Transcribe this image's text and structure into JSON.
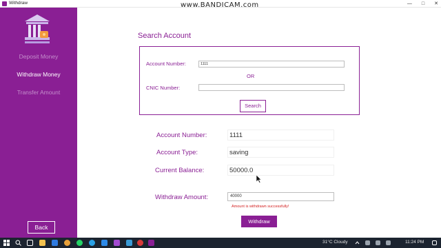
{
  "window": {
    "title": "Withdraw",
    "controls": [
      "—",
      "□",
      "✕"
    ]
  },
  "watermark": "www.BANDICAM.com",
  "sidebar": {
    "items": [
      {
        "label": "Deposit Money",
        "active": false
      },
      {
        "label": "Withdraw Money",
        "active": true
      },
      {
        "label": "Transfer Amount",
        "active": false
      }
    ],
    "back_label": "Back"
  },
  "search": {
    "heading": "Search Account",
    "account_number_label": "Account Number:",
    "account_number_value": "1111",
    "or_label": "OR",
    "cnic_label": "CNIC Number:",
    "cnic_value": "",
    "button_label": "Search"
  },
  "details": {
    "account_number_label": "Account Number:",
    "account_number_value": "1111",
    "account_type_label": "Account Type:",
    "account_type_value": "saving",
    "balance_label": "Current Balance:",
    "balance_value": "50000.0"
  },
  "withdraw": {
    "amount_label": "Withdraw Amount:",
    "amount_value": "40000",
    "message": "Amount is withdrawn successfully!",
    "button_label": "Withdraw"
  },
  "taskbar": {
    "weather": "31°C  Cloudy",
    "time": "11:24 PM"
  },
  "colors": {
    "accent": "#8a1f94",
    "error": "#d32020",
    "taskbar": "#1c2430"
  }
}
